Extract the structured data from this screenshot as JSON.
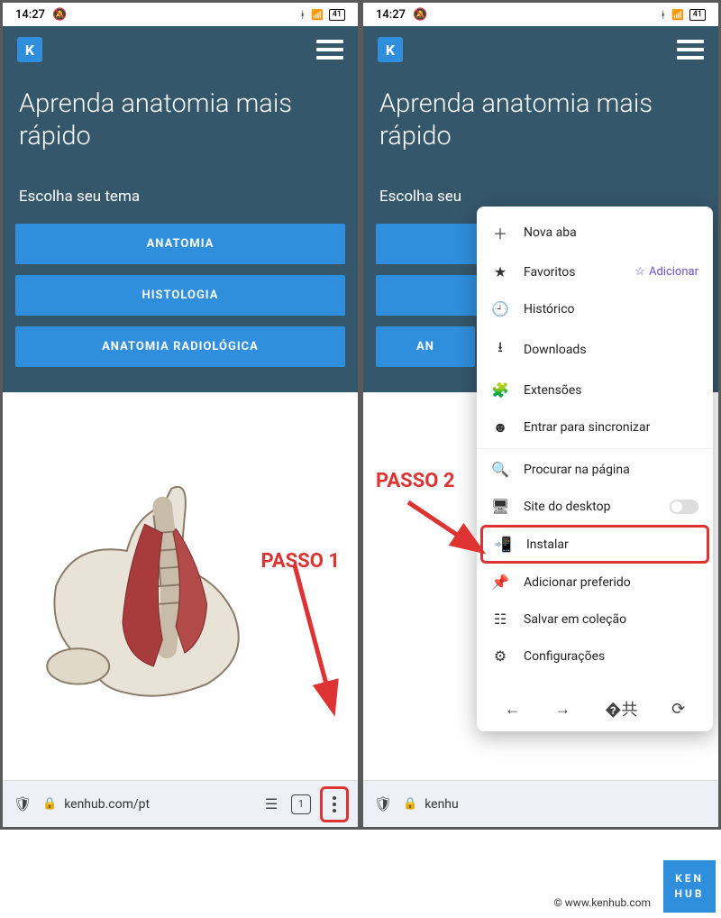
{
  "status": {
    "time": "14:27",
    "alarm_icon": "🔕",
    "bt": "⚡",
    "sig": "📶",
    "batt": "41"
  },
  "app": {
    "logo_letter": "K",
    "hero": "Aprenda anatomia mais rápido",
    "sub": "Escolha seu tema",
    "topics": [
      "ANATOMIA",
      "HISTOLOGIA",
      "ANATOMIA RADIOLÓGICA"
    ],
    "partial_topic": "AN"
  },
  "bottombar": {
    "url": "kenhub.com/pt",
    "url_short": "kenhu",
    "tab_count": "1"
  },
  "sub_truncated": "Escolha seu",
  "menu": {
    "items": [
      {
        "icon": "＋",
        "label": "Nova aba"
      },
      {
        "icon": "★",
        "label": "Favoritos",
        "trail_icon": "☆",
        "trail": "Adicionar"
      },
      {
        "icon": "🕘",
        "label": "Histórico"
      },
      {
        "icon": "⭳",
        "label": "Downloads"
      },
      {
        "icon": "🧩",
        "label": "Extensões"
      },
      {
        "icon": "☻",
        "label": "Entrar para sincronizar"
      },
      {
        "icon": "🔍",
        "label": "Procurar na página"
      },
      {
        "icon": "🖥",
        "label": "Site do desktop",
        "toggle": true
      },
      {
        "icon": "📲",
        "label": "Instalar",
        "highlight": true
      },
      {
        "icon": "📌",
        "label": "Adicionar preferido"
      },
      {
        "icon": "☷",
        "label": "Salvar em coleção"
      },
      {
        "icon": "⚙",
        "label": "Configurações"
      }
    ]
  },
  "annotations": {
    "step1": "PASSO 1",
    "step2": "PASSO 2"
  },
  "footer": {
    "copyright": "© www.kenhub.com",
    "brand": "KEN\nHUB"
  }
}
